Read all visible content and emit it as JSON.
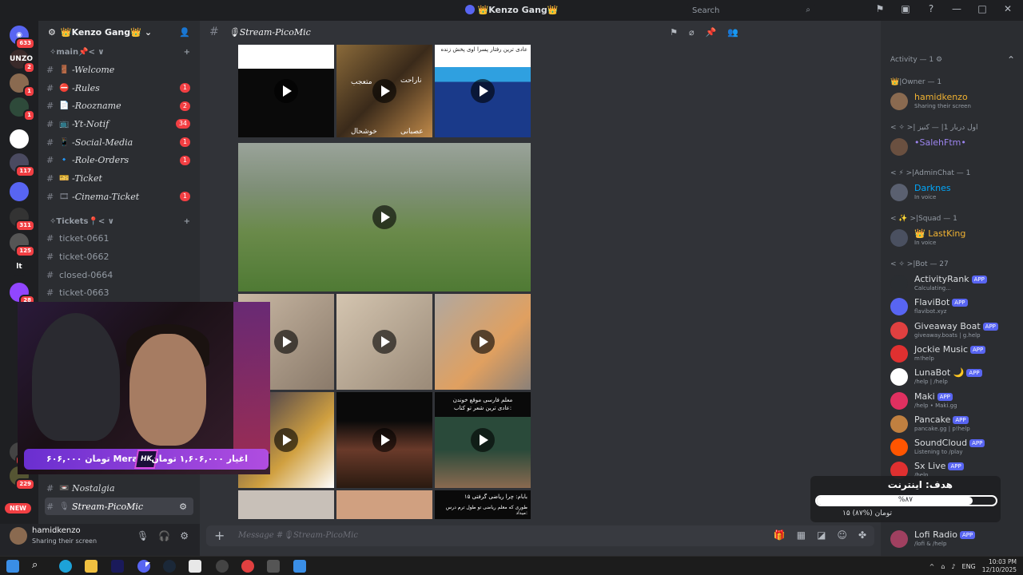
{
  "window": {
    "title": "👑Kenzo Gang👑",
    "controls": [
      "⚑",
      "▣",
      "?",
      "—",
      "□",
      "✕"
    ]
  },
  "server_rail": {
    "badges": [
      "633",
      "2",
      "1",
      "1",
      "117",
      "311",
      "125",
      "28",
      "422",
      "229"
    ],
    "labels": [
      "UNZO",
      "lt"
    ],
    "new_badge": "NEW"
  },
  "server_header": {
    "name": "👑Kenzo Gang👑"
  },
  "categories": {
    "main": "✧main📌< ∨",
    "tickets": "✧Tickets📍< ∨"
  },
  "channels_main": [
    {
      "icon": "🚪",
      "name": "-Welcome",
      "badge": ""
    },
    {
      "icon": "⛔",
      "name": "-Rules",
      "badge": "1"
    },
    {
      "icon": "📄",
      "name": "-Roozname",
      "badge": "2"
    },
    {
      "icon": "📺",
      "name": "-Yt-Notif",
      "badge": "34"
    },
    {
      "icon": "📱",
      "name": "-Social-Media",
      "badge": "1"
    },
    {
      "icon": "🔹",
      "name": "-Role-Orders",
      "badge": "1"
    },
    {
      "icon": "🎫",
      "name": "-Ticket",
      "badge": ""
    },
    {
      "icon": "🎞",
      "name": "-Cinema-Ticket",
      "badge": "1"
    }
  ],
  "channels_tickets": [
    "ticket-0661",
    "ticket-0662",
    "closed-0664",
    "ticket-0663"
  ],
  "channels_bottom": [
    {
      "icon": "📼",
      "name": "Nostalgia"
    },
    {
      "icon": "🎙",
      "name": "Stream-PicoMic"
    }
  ],
  "user": {
    "name": "hamidkenzo",
    "status": "Sharing their screen"
  },
  "channel_header": {
    "name": "🎙Stream-PicoMic"
  },
  "search": {
    "placeholder": "Search"
  },
  "media_text": {
    "lion_1": "متعجب",
    "lion_2": "ناراحت",
    "lion_3": "خوشحال",
    "lion_4": "عصبانی",
    "news_caption": "عادی ترین رفتار پسرا اوی پخش زنده",
    "class_1": "معلم فارسی موقع خوندن",
    "class_2": "عادی ترین شعر تو کتاب:",
    "math_1": "بابام: چرا ریاضی گرفتی ۱۵",
    "math_2": "طوری که معلم ریاضی تو طول ترم درس میداد:"
  },
  "composer": {
    "placeholder": "Message #🎙Stream-PicoMic"
  },
  "members": {
    "activity_header": "Activity — 1 ⚙",
    "groups": [
      {
        "label": "👑|Owner — 1"
      },
      {
        "label": "< ✧ >| اول دربار 1| — کنیز"
      },
      {
        "label": "< ⚡ >|AdminChat — 1"
      },
      {
        "label": "< ✨ >|Squad — 1"
      },
      {
        "label": "< ✧ >|Bot — 27"
      }
    ],
    "people": [
      {
        "name": "hamidkenzo",
        "sub": "Sharing their screen",
        "color": "#f0b232"
      },
      {
        "name": "•SalehFtm•",
        "sub": "",
        "color": "#9c84ef"
      },
      {
        "name": "Darknes",
        "sub": "In voice",
        "color": "#00a8fc"
      },
      {
        "name": "👑 LastKing",
        "sub": "In voice",
        "color": "#f0b232"
      }
    ],
    "bots": [
      {
        "name": "ActivityRank",
        "sub": "Calculating..."
      },
      {
        "name": "FlaviBot",
        "sub": "flavibot.xyz"
      },
      {
        "name": "Giveaway Boat",
        "sub": "giveaway.boats | g.help"
      },
      {
        "name": "Jockie Music",
        "sub": "m!help"
      },
      {
        "name": "LunaBot 🌙",
        "sub": "/help | /help"
      },
      {
        "name": "Maki",
        "sub": "/help • Maki.gg"
      },
      {
        "name": "Pancake",
        "sub": "pancake.gg | p!help"
      },
      {
        "name": "SoundCloud",
        "sub": "Listening to /play"
      },
      {
        "name": "Sx Live",
        "sub": "/help"
      },
      {
        "name": "Lofi Radio",
        "sub": "/lofi & /help"
      }
    ],
    "app_tag": "APP"
  },
  "stream_overlay": {
    "donate_left": "۶۰۶,۰۰۰ تومان Meraj",
    "donate_right": "اغیار ۱,۶۰۶,۰۰۰ تومان",
    "hk": "HK",
    "goal_title": "هدف: اینترنت",
    "goal_pct_label": "%۸۷",
    "goal_progress": 0.87,
    "goal_sub": "۱۵ تومان (%۸۷)"
  },
  "taskbar": {
    "lang": "ENG",
    "time": "10:03 PM",
    "date": "12/10/2025"
  }
}
